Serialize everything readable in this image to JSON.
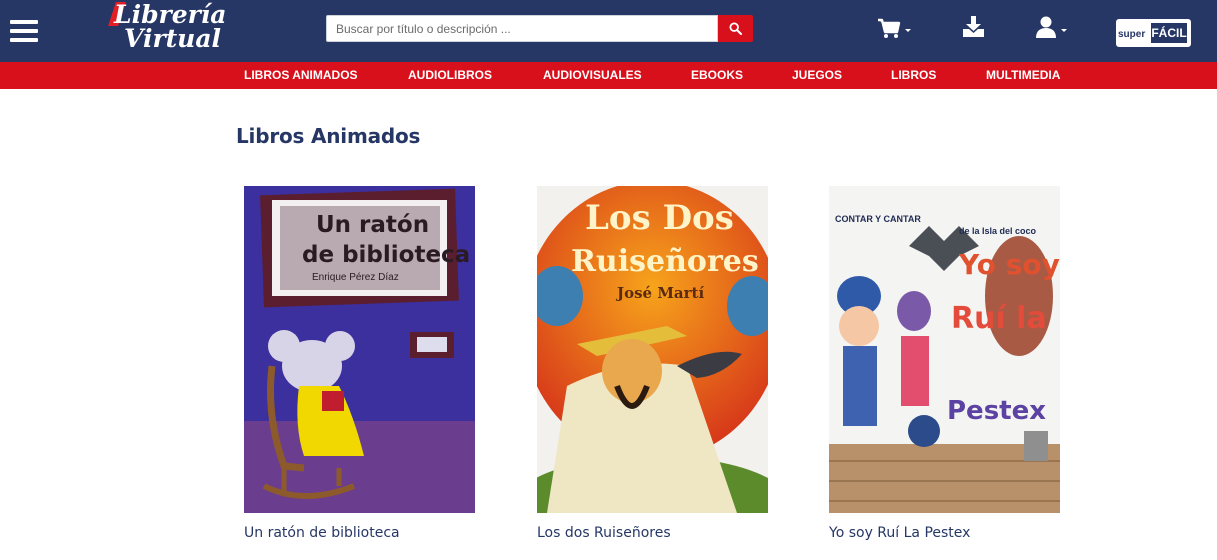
{
  "header": {
    "logo": {
      "line1": "Librería",
      "line2": "Virtual"
    },
    "search": {
      "placeholder": "Buscar por título o descripción ..."
    },
    "superfacil": {
      "super": "super",
      "facil": "FÁCIL"
    },
    "icons": [
      "menu-icon",
      "search-icon",
      "cart-icon",
      "download-icon",
      "user-icon"
    ]
  },
  "nav": {
    "items": [
      {
        "label": "LIBROS ANIMADOS"
      },
      {
        "label": "AUDIOLIBROS"
      },
      {
        "label": "AUDIOVISUALES"
      },
      {
        "label": "EBOOKS"
      },
      {
        "label": "JUEGOS"
      },
      {
        "label": "LIBROS"
      },
      {
        "label": "MULTIMEDIA"
      }
    ]
  },
  "main": {
    "title": "Libros Animados",
    "books": [
      {
        "title": "Un ratón de biblioteca",
        "cover": {
          "line1": "Un ratón",
          "line2": "de biblioteca",
          "author": "Enrique Pérez Díaz"
        }
      },
      {
        "title": "Los dos Ruiseñores",
        "cover": {
          "line1": "Los Dos",
          "line2": "Ruiseñores",
          "author": "José Martí"
        }
      },
      {
        "title": "Yo soy Ruí La Pestex",
        "cover": {
          "collection": "CONTAR Y CANTAR",
          "subtitle": "de la Isla del coco",
          "line1": "Yo soy",
          "line2": "Ruí la",
          "line3": "Pestex"
        }
      }
    ]
  },
  "colors": {
    "header_bg": "#263766",
    "nav_bg": "#d8101c",
    "title_color": "#263766"
  }
}
